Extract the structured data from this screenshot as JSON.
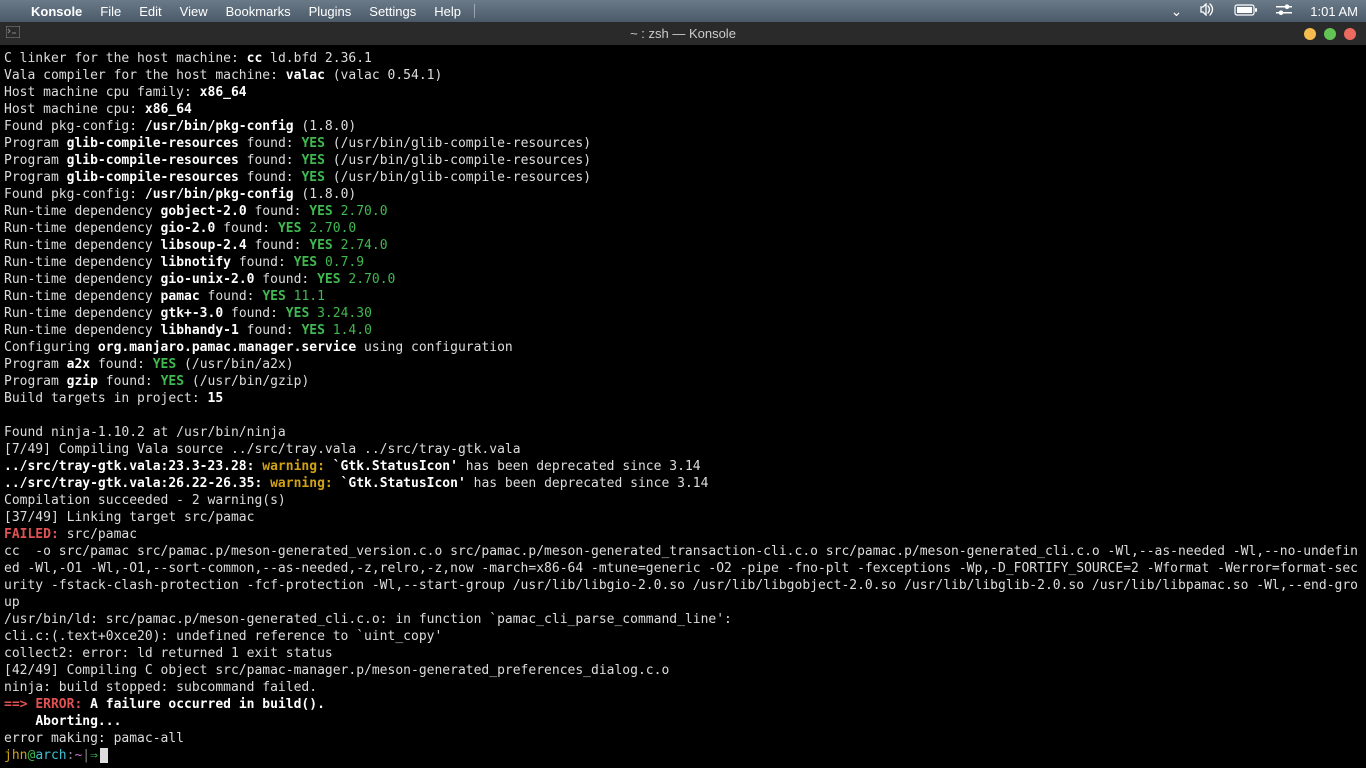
{
  "menubar": {
    "app_name": "Konsole",
    "items": [
      "File",
      "Edit",
      "View",
      "Bookmarks",
      "Plugins",
      "Settings",
      "Help"
    ],
    "clock": "1:01 AM"
  },
  "window": {
    "title": "~ : zsh — Konsole"
  },
  "terminal": {
    "lines": [
      {
        "segments": [
          {
            "t": "C linker for the host machine: "
          },
          {
            "t": "cc",
            "c": "b"
          },
          {
            "t": " ld.bfd 2.36.1"
          }
        ]
      },
      {
        "segments": [
          {
            "t": "Vala compiler for the host machine: "
          },
          {
            "t": "valac",
            "c": "b"
          },
          {
            "t": " (valac 0.54.1)"
          }
        ]
      },
      {
        "segments": [
          {
            "t": "Host machine cpu family: "
          },
          {
            "t": "x86_64",
            "c": "b"
          }
        ]
      },
      {
        "segments": [
          {
            "t": "Host machine cpu: "
          },
          {
            "t": "x86_64",
            "c": "b"
          }
        ]
      },
      {
        "segments": [
          {
            "t": "Found pkg-config: "
          },
          {
            "t": "/usr/bin/pkg-config",
            "c": "b"
          },
          {
            "t": " (1.8.0)"
          }
        ]
      },
      {
        "segments": [
          {
            "t": "Program "
          },
          {
            "t": "glib-compile-resources",
            "c": "b"
          },
          {
            "t": " found: "
          },
          {
            "t": "YES",
            "c": "yes"
          },
          {
            "t": " (/usr/bin/glib-compile-resources)"
          }
        ]
      },
      {
        "segments": [
          {
            "t": "Program "
          },
          {
            "t": "glib-compile-resources",
            "c": "b"
          },
          {
            "t": " found: "
          },
          {
            "t": "YES",
            "c": "yes"
          },
          {
            "t": " (/usr/bin/glib-compile-resources)"
          }
        ]
      },
      {
        "segments": [
          {
            "t": "Program "
          },
          {
            "t": "glib-compile-resources",
            "c": "b"
          },
          {
            "t": " found: "
          },
          {
            "t": "YES",
            "c": "yes"
          },
          {
            "t": " (/usr/bin/glib-compile-resources)"
          }
        ]
      },
      {
        "segments": [
          {
            "t": "Found pkg-config: "
          },
          {
            "t": "/usr/bin/pkg-config",
            "c": "b"
          },
          {
            "t": " (1.8.0)"
          }
        ]
      },
      {
        "segments": [
          {
            "t": "Run-time dependency "
          },
          {
            "t": "gobject-2.0",
            "c": "b"
          },
          {
            "t": " found: "
          },
          {
            "t": "YES",
            "c": "yes"
          },
          {
            "t": " "
          },
          {
            "t": "2.70.0",
            "c": "ver"
          }
        ]
      },
      {
        "segments": [
          {
            "t": "Run-time dependency "
          },
          {
            "t": "gio-2.0",
            "c": "b"
          },
          {
            "t": " found: "
          },
          {
            "t": "YES",
            "c": "yes"
          },
          {
            "t": " "
          },
          {
            "t": "2.70.0",
            "c": "ver"
          }
        ]
      },
      {
        "segments": [
          {
            "t": "Run-time dependency "
          },
          {
            "t": "libsoup-2.4",
            "c": "b"
          },
          {
            "t": " found: "
          },
          {
            "t": "YES",
            "c": "yes"
          },
          {
            "t": " "
          },
          {
            "t": "2.74.0",
            "c": "ver"
          }
        ]
      },
      {
        "segments": [
          {
            "t": "Run-time dependency "
          },
          {
            "t": "libnotify",
            "c": "b"
          },
          {
            "t": " found: "
          },
          {
            "t": "YES",
            "c": "yes"
          },
          {
            "t": " "
          },
          {
            "t": "0.7.9",
            "c": "ver"
          }
        ]
      },
      {
        "segments": [
          {
            "t": "Run-time dependency "
          },
          {
            "t": "gio-unix-2.0",
            "c": "b"
          },
          {
            "t": " found: "
          },
          {
            "t": "YES",
            "c": "yes"
          },
          {
            "t": " "
          },
          {
            "t": "2.70.0",
            "c": "ver"
          }
        ]
      },
      {
        "segments": [
          {
            "t": "Run-time dependency "
          },
          {
            "t": "pamac",
            "c": "b"
          },
          {
            "t": " found: "
          },
          {
            "t": "YES",
            "c": "yes"
          },
          {
            "t": " "
          },
          {
            "t": "11.1",
            "c": "ver"
          }
        ]
      },
      {
        "segments": [
          {
            "t": "Run-time dependency "
          },
          {
            "t": "gtk+-3.0",
            "c": "b"
          },
          {
            "t": " found: "
          },
          {
            "t": "YES",
            "c": "yes"
          },
          {
            "t": " "
          },
          {
            "t": "3.24.30",
            "c": "ver"
          }
        ]
      },
      {
        "segments": [
          {
            "t": "Run-time dependency "
          },
          {
            "t": "libhandy-1",
            "c": "b"
          },
          {
            "t": " found: "
          },
          {
            "t": "YES",
            "c": "yes"
          },
          {
            "t": " "
          },
          {
            "t": "1.4.0",
            "c": "ver"
          }
        ]
      },
      {
        "segments": [
          {
            "t": "Configuring "
          },
          {
            "t": "org.manjaro.pamac.manager.service",
            "c": "b"
          },
          {
            "t": " using configuration"
          }
        ]
      },
      {
        "segments": [
          {
            "t": "Program "
          },
          {
            "t": "a2x",
            "c": "b"
          },
          {
            "t": " found: "
          },
          {
            "t": "YES",
            "c": "yes"
          },
          {
            "t": " (/usr/bin/a2x)"
          }
        ]
      },
      {
        "segments": [
          {
            "t": "Program "
          },
          {
            "t": "gzip",
            "c": "b"
          },
          {
            "t": " found: "
          },
          {
            "t": "YES",
            "c": "yes"
          },
          {
            "t": " (/usr/bin/gzip)"
          }
        ]
      },
      {
        "segments": [
          {
            "t": "Build targets in project: "
          },
          {
            "t": "15",
            "c": "b"
          }
        ]
      },
      {
        "segments": [
          {
            "t": " "
          }
        ]
      },
      {
        "segments": [
          {
            "t": "Found ninja-1.10.2 at /usr/bin/ninja"
          }
        ]
      },
      {
        "segments": [
          {
            "t": "[7/49] Compiling Vala source ../src/tray.vala ../src/tray-gtk.vala"
          }
        ]
      },
      {
        "segments": [
          {
            "t": "../src/tray-gtk.vala:23.3-23.28: ",
            "c": "b"
          },
          {
            "t": "warning: ",
            "c": "warn"
          },
          {
            "t": "`Gtk.StatusIcon'",
            "c": "b"
          },
          {
            "t": " has been deprecated since 3.14"
          }
        ]
      },
      {
        "segments": [
          {
            "t": "../src/tray-gtk.vala:26.22-26.35: ",
            "c": "b"
          },
          {
            "t": "warning: ",
            "c": "warn"
          },
          {
            "t": "`Gtk.StatusIcon'",
            "c": "b"
          },
          {
            "t": " has been deprecated since 3.14"
          }
        ]
      },
      {
        "segments": [
          {
            "t": "Compilation succeeded - 2 warning(s)"
          }
        ]
      },
      {
        "segments": [
          {
            "t": "[37/49] Linking target src/pamac"
          }
        ]
      },
      {
        "segments": [
          {
            "t": "FAILED: ",
            "c": "fail"
          },
          {
            "t": "src/pamac"
          }
        ]
      },
      {
        "segments": [
          {
            "t": "cc  -o src/pamac src/pamac.p/meson-generated_version.c.o src/pamac.p/meson-generated_transaction-cli.c.o src/pamac.p/meson-generated_cli.c.o -Wl,--as-needed -Wl,--no-undefined -Wl,-O1 -Wl,-O1,--sort-common,--as-needed,-z,relro,-z,now -march=x86-64 -mtune=generic -O2 -pipe -fno-plt -fexceptions -Wp,-D_FORTIFY_SOURCE=2 -Wformat -Werror=format-security -fstack-clash-protection -fcf-protection -Wl,--start-group /usr/lib/libgio-2.0.so /usr/lib/libgobject-2.0.so /usr/lib/libglib-2.0.so /usr/lib/libpamac.so -Wl,--end-group"
          }
        ]
      },
      {
        "segments": [
          {
            "t": "/usr/bin/ld: src/pamac.p/meson-generated_cli.c.o: in function `pamac_cli_parse_command_line':"
          }
        ]
      },
      {
        "segments": [
          {
            "t": "cli.c:(.text+0xce20): undefined reference to `uint_copy'"
          }
        ]
      },
      {
        "segments": [
          {
            "t": "collect2: error: ld returned 1 exit status"
          }
        ]
      },
      {
        "segments": [
          {
            "t": "[42/49] Compiling C object src/pamac-manager.p/meson-generated_preferences_dialog.c.o"
          }
        ]
      },
      {
        "segments": [
          {
            "t": "ninja: build stopped: subcommand failed."
          }
        ]
      },
      {
        "segments": [
          {
            "t": "==> ",
            "c": "arrow-red"
          },
          {
            "t": "ERROR: ",
            "c": "err-red"
          },
          {
            "t": "A failure occurred in build().",
            "c": "b"
          }
        ]
      },
      {
        "segments": [
          {
            "t": "    Aborting...",
            "c": "b"
          }
        ]
      },
      {
        "segments": [
          {
            "t": "error making: pamac-all"
          }
        ]
      }
    ],
    "prompt": {
      "user": "jhn",
      "at": "@",
      "host": "arch",
      "sep": ":",
      "cwd": "~",
      "pipe": "|",
      "arrow": "⇒"
    }
  }
}
